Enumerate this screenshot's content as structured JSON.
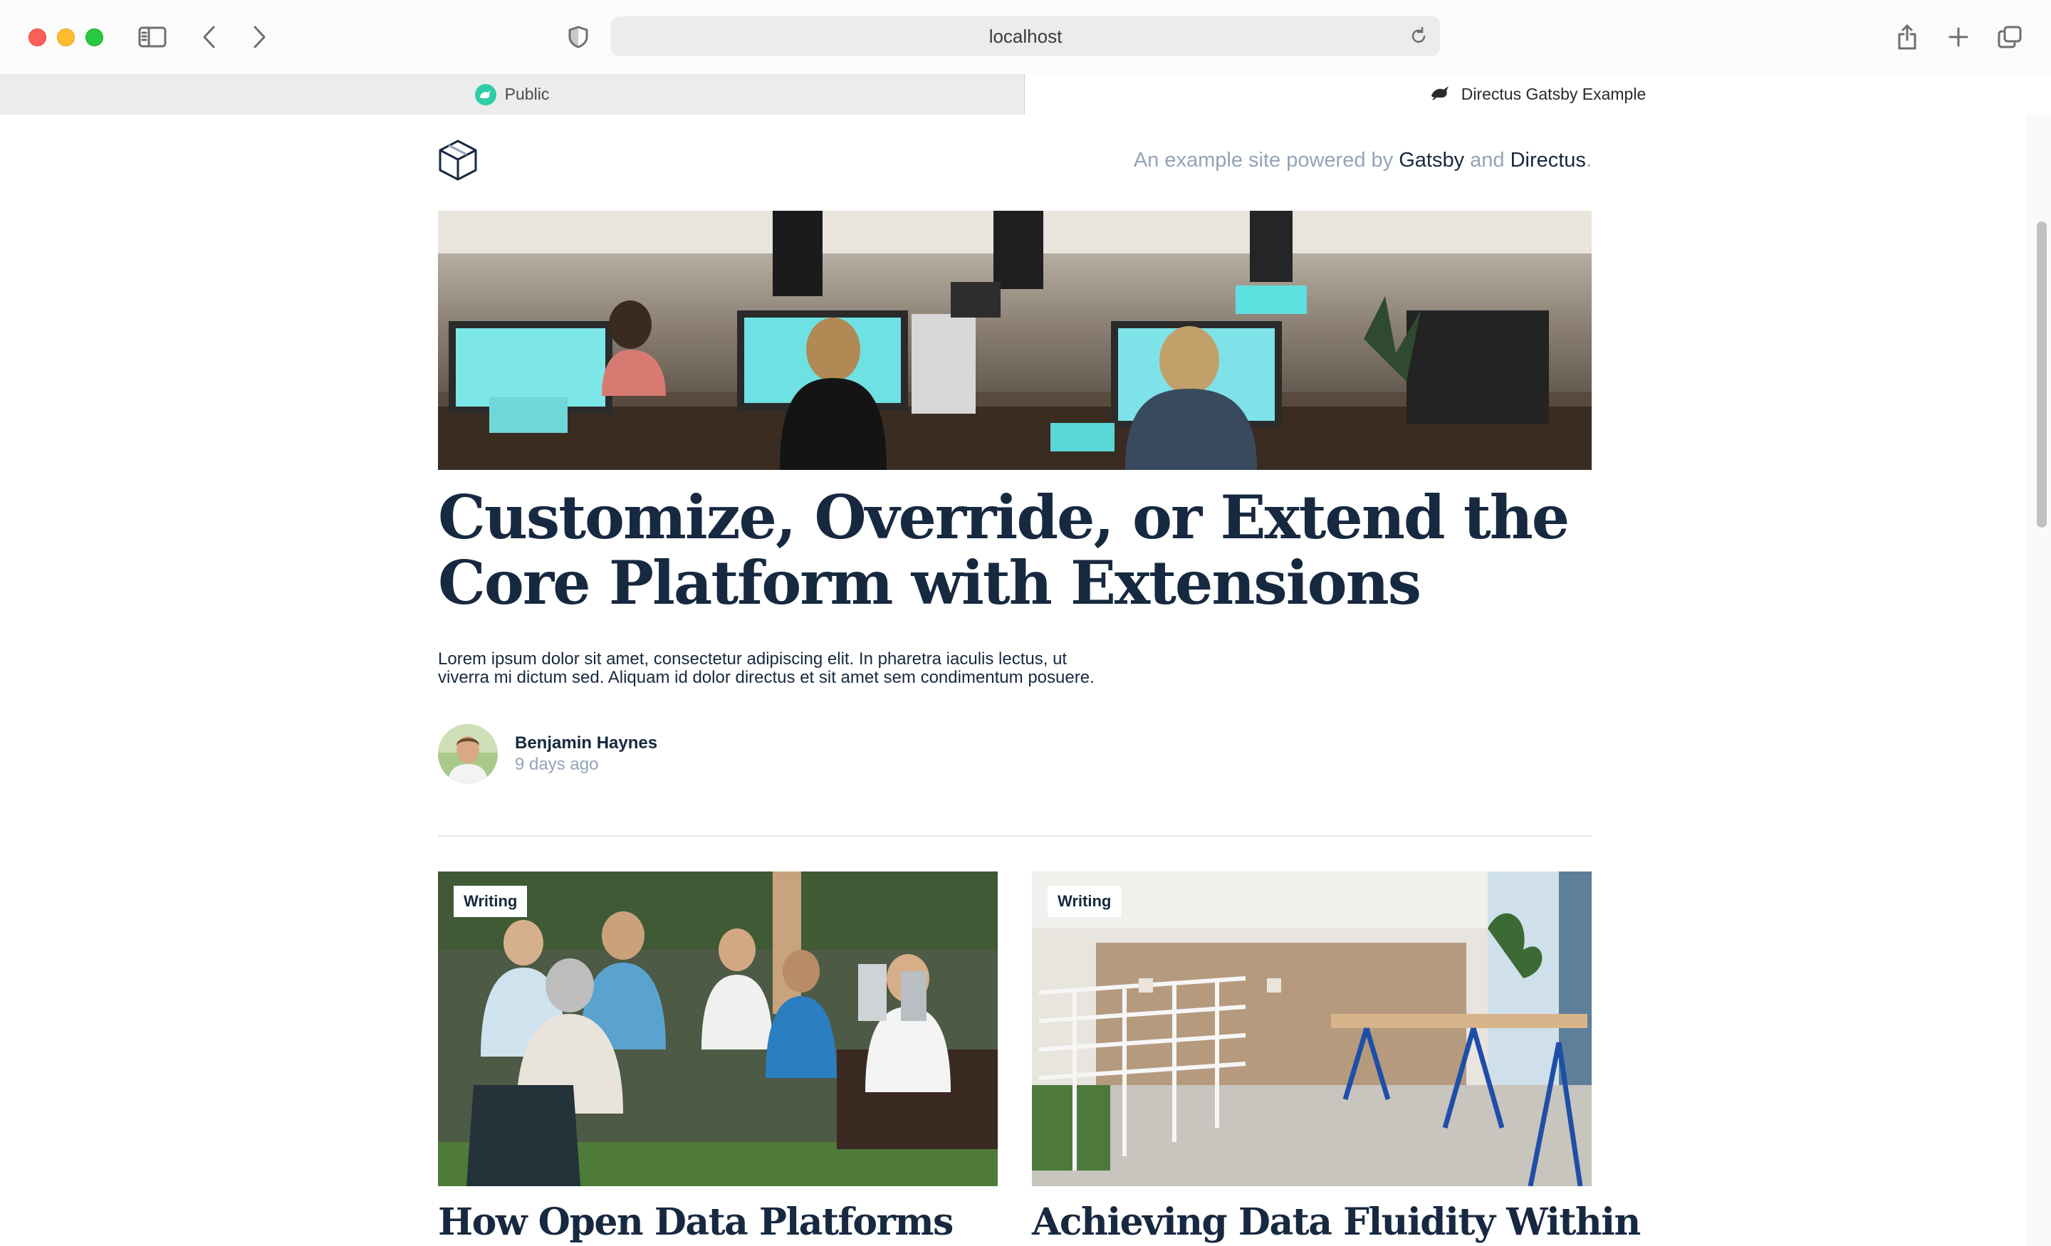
{
  "browser": {
    "address": "localhost",
    "tabs": [
      {
        "label": "Public"
      },
      {
        "label": "Directus Gatsby Example"
      }
    ]
  },
  "header": {
    "tagline_prefix": "An example site powered by ",
    "tagline_gatsby": "Gatsby",
    "tagline_and": " and ",
    "tagline_directus": "Directus",
    "tagline_suffix": "."
  },
  "hero": {
    "title": "Customize, Override, or Extend the Core Platform with Extensions",
    "excerpt": "Lorem ipsum dolor sit amet, consectetur adipiscing elit. In pharetra iaculis lectus, ut viverra mi dictum sed. Aliquam id dolor directus et sit amet sem condimentum posuere.",
    "author_name": "Benjamin Haynes",
    "author_date": "9 days ago"
  },
  "articles": [
    {
      "category": "Writing",
      "title": "How Open Data Platforms"
    },
    {
      "category": "Writing",
      "title": "Achieving Data Fluidity Within"
    }
  ],
  "colors": {
    "ink": "#172940",
    "muted": "#94a3b8",
    "accent_teal": "#2ecda7"
  }
}
